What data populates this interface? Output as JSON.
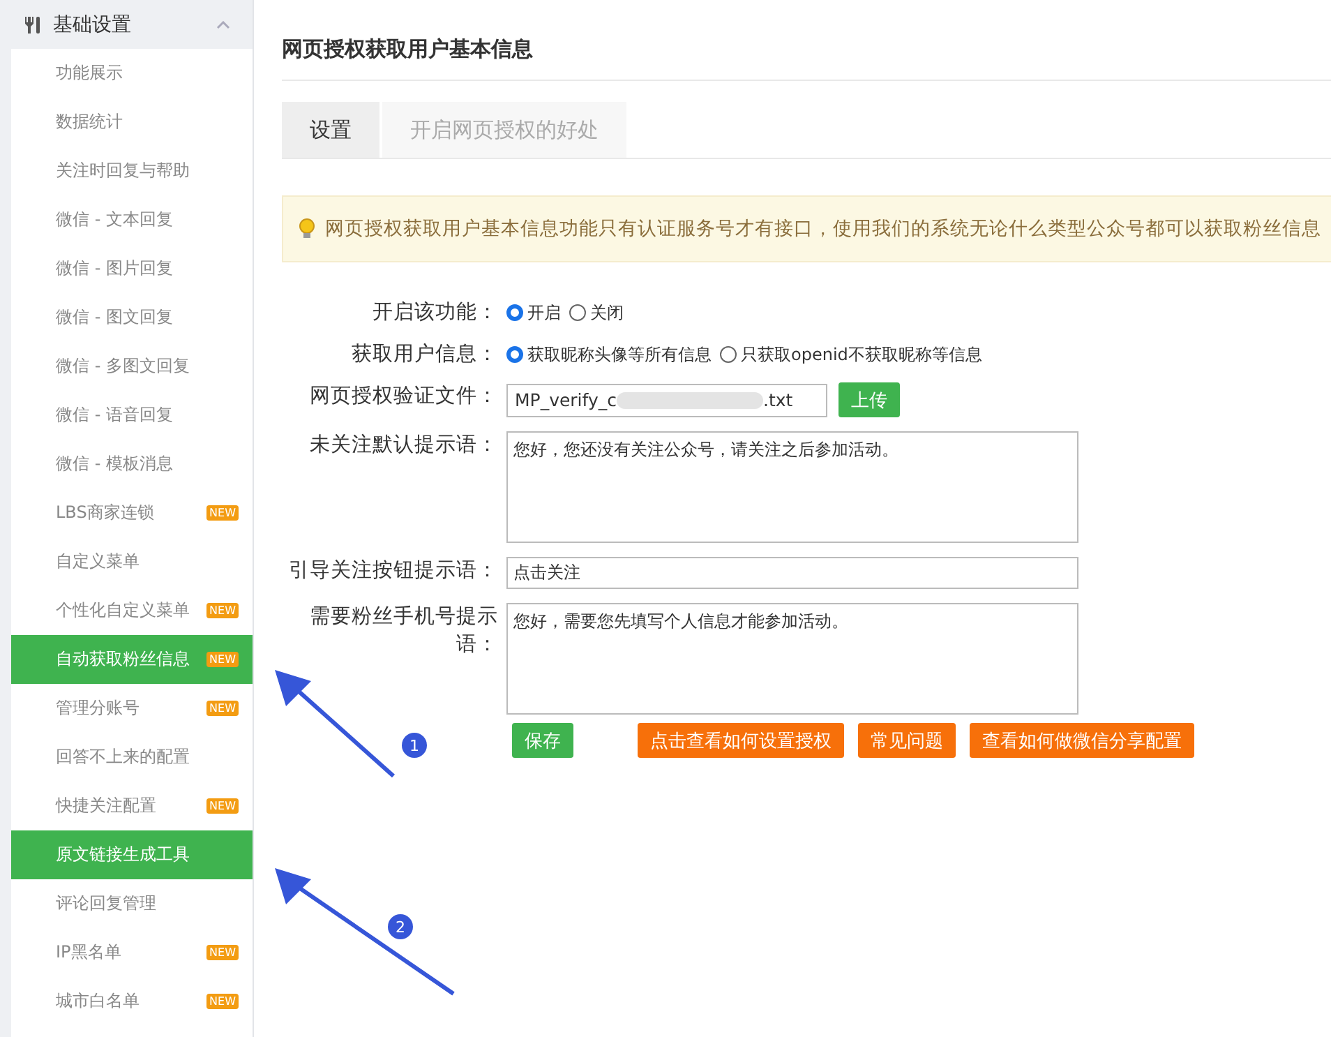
{
  "sidebar": {
    "header": {
      "label": "基础设置",
      "expanded": true
    },
    "items": [
      {
        "label": "功能展示",
        "selected": false
      },
      {
        "label": "数据统计",
        "selected": false
      },
      {
        "label": "关注时回复与帮助",
        "selected": false
      },
      {
        "label": "微信 - 文本回复",
        "selected": false
      },
      {
        "label": "微信 - 图片回复",
        "selected": false
      },
      {
        "label": "微信 - 图文回复",
        "selected": false
      },
      {
        "label": "微信 - 多图文回复",
        "selected": false
      },
      {
        "label": "微信 - 语音回复",
        "selected": false
      },
      {
        "label": "微信 - 模板消息",
        "selected": false
      },
      {
        "label": "LBS商家连锁",
        "selected": false,
        "badge": "NEW"
      },
      {
        "label": "自定义菜单",
        "selected": false
      },
      {
        "label": "个性化自定义菜单",
        "selected": false,
        "badge": "NEW"
      },
      {
        "label": "自动获取粉丝信息",
        "selected": true,
        "badge": "NEW"
      },
      {
        "label": "管理分账号",
        "selected": false,
        "badge": "NEW"
      },
      {
        "label": "回答不上来的配置",
        "selected": false
      },
      {
        "label": "快捷关注配置",
        "selected": false,
        "badge": "NEW"
      },
      {
        "label": "原文链接生成工具",
        "selected": true
      },
      {
        "label": "评论回复管理",
        "selected": false
      },
      {
        "label": "IP黑名单",
        "selected": false,
        "badge": "NEW"
      },
      {
        "label": "城市白名单",
        "selected": false,
        "badge": "NEW"
      }
    ]
  },
  "page_title": "网页授权获取用户基本信息",
  "tabs": [
    {
      "label": "设置",
      "selected": true
    },
    {
      "label": "开启网页授权的好处",
      "selected": false
    }
  ],
  "notice": "网页授权获取用户基本信息功能只有认证服务号才有接口，使用我们的系统无论什么类型公众号都可以获取粉丝信息",
  "form": [
    {
      "kind": "radio",
      "label": "开启该功能：",
      "options": [
        {
          "label": "开启",
          "selected": true
        },
        {
          "label": "关闭",
          "selected": false
        }
      ]
    },
    {
      "kind": "radio",
      "label": "获取用户信息：",
      "options": [
        {
          "label": "获取昵称头像等所有信息",
          "selected": true
        },
        {
          "label": "只获取openid不获取昵称等信息",
          "selected": false
        }
      ]
    },
    {
      "kind": "file",
      "label": "网页授权验证文件：",
      "value_start": "MP_verify_c",
      "value_end": ".txt",
      "button": "上传"
    },
    {
      "kind": "textarea",
      "label": "未关注默认提示语：",
      "value": "您好，您还没有关注公众号，请关注之后参加活动。"
    },
    {
      "kind": "input",
      "label": "引导关注按钮提示语：",
      "value": "点击关注"
    },
    {
      "kind": "textarea",
      "label": "需要粉丝手机号提示语：",
      "value": "您好，需要您先填写个人信息才能参加活动。"
    }
  ],
  "actions": [
    {
      "label": "保存",
      "kind": "primary"
    },
    {
      "label": "点击查看如何设置授权",
      "kind": "warning"
    },
    {
      "label": "常见问题",
      "kind": "warning"
    },
    {
      "label": "查看如何做微信分享配置",
      "kind": "warning"
    }
  ],
  "annotations": [
    "1",
    "2"
  ]
}
